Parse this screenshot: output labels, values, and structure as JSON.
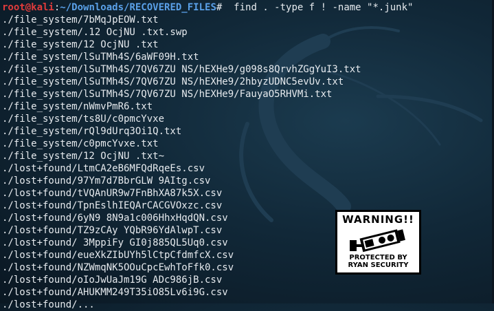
{
  "prompt": {
    "user": "root@kali",
    "separator": ":",
    "path": "~/Downloads/RECOVERED_FILES",
    "symbol": "#",
    "command": "  find . -type f ! -name \"*.junk\""
  },
  "output_lines": [
    "./file_system/7bMqJpEOW.txt",
    "./file_system/.12 OcjNU .txt.swp",
    "./file_system/12 OcjNU .txt",
    "./file_system/lSuTMh4S/6aWF09H.txt",
    "./file_system/lSuTMh4S/7QV67ZU NS/hEXHe9/g098s8QrvhZGgYuI3.txt",
    "./file_system/lSuTMh4S/7QV67ZU NS/hEXHe9/2hbyzUDNC5evUv.txt",
    "./file_system/lSuTMh4S/7QV67ZU NS/hEXHe9/FauyaO5RHVMi.txt",
    "./file_system/nWmvPmR6.txt",
    "./file_system/ts8U/c0pmcYvxe",
    "./file_system/rQl9dUrq3Oi1Q.txt",
    "./file_system/c0pmcYvxe.txt",
    "./file_system/12 OcjNU .txt~",
    "./lost+found/LtmCA2eB6MFQdRqeEs.csv",
    "./lost+found/97Ym7d7BbrGLW 9AItg.csv",
    "./lost+found/tVQAnUR9w7FnBhXA87k5X.csv",
    "./lost+found/TpnEslhIEQArCACGVOxzc.csv",
    "./lost+found/6yN9 8N9a1c006HhxHqdQN.csv",
    "./lost+found/TZ9zCAy YQbR96YdAlwpT.csv",
    "./lost+found/ 3MppiFy GI0j885QL5Uq0.csv",
    "./lost+found/eueXkZIbUYh5lCtpCfdmfcX.csv",
    "./lost+found/NZWmqNK5OOuCpcEwhToFfk0.csv",
    "./lost+found/oIoJwUaJm19G ADc986jB.csv",
    "./lost+found/AHUKMM249T35iO85Lv6i9G.csv",
    "./lost+found/..."
  ],
  "warning_sign": {
    "title": "WARNING!!",
    "line1": "PROTECTED BY",
    "line2": "RYAN SECURITY",
    "icon": "security-camera-icon"
  },
  "colors": {
    "prompt_user": "#e03b3b",
    "prompt_path": "#5aa0e8",
    "background": "#112838",
    "text": "#e6eaee"
  }
}
